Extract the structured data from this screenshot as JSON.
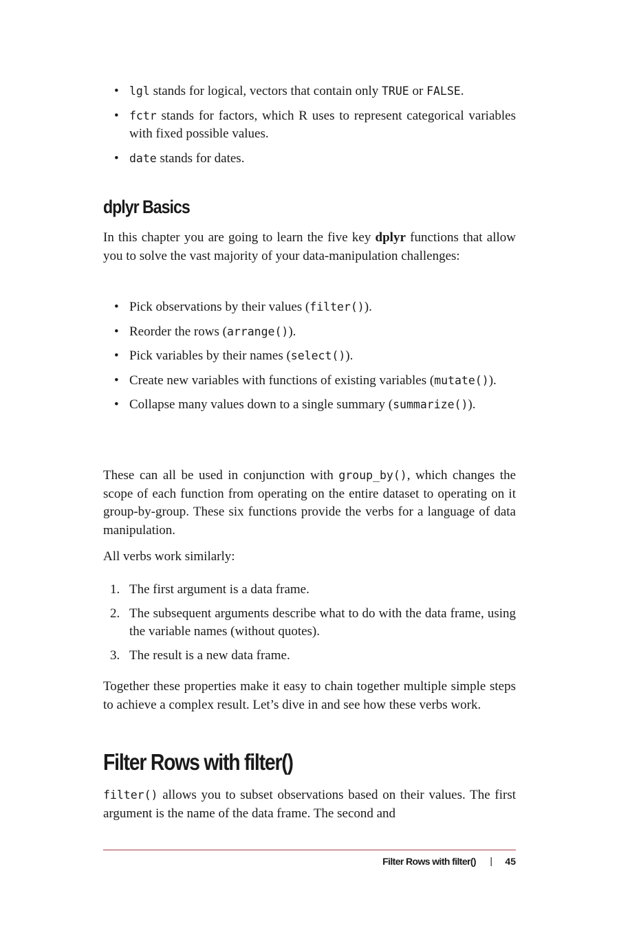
{
  "types_list": [
    {
      "code": "lgl",
      "text": " stands for logical, vectors that contain only ",
      "code2": "TRUE",
      "text2": " or ",
      "code3": "FALSE",
      "text3": "."
    },
    {
      "code": "fctr",
      "text": " stands for factors, which R uses to represent categorical variables with fixed possible values."
    },
    {
      "code": "date",
      "text": " stands for dates."
    }
  ],
  "section": {
    "heading": "dplyr Basics",
    "intro_before": "In this chapter you are going to learn the five key ",
    "intro_bold": "dplyr",
    "intro_after": " functions that allow you to solve the vast majority of your data-manipulation challenges:",
    "functions_list": [
      {
        "text": "Pick observations by their values (",
        "code": "filter()",
        "end": ")."
      },
      {
        "text": "Reorder the rows (",
        "code": "arrange()",
        "end": ")."
      },
      {
        "text": "Pick variables by their names (",
        "code": "select()",
        "end": ")."
      },
      {
        "text": "Create new variables with functions of existing variables (",
        "code": "mutate()",
        "end": ")."
      },
      {
        "text": "Collapse many values down to a single summary (",
        "code": "summarize()",
        "end": ")."
      }
    ],
    "group_by_before": "These can all be used in conjunction with ",
    "group_by_code": "group_by()",
    "group_by_after": ", which changes the scope of each function from operating on the entire dataset to operating on it group-by-group. These six functions provide the verbs for a language of data manipulation.",
    "verbs_intro": "All verbs work similarly:",
    "steps": [
      {
        "num": "1.",
        "text": "The first argument is a data frame."
      },
      {
        "num": "2.",
        "text": "The subsequent arguments describe what to do with the data frame, using the variable names (without quotes)."
      },
      {
        "num": "3.",
        "text": "The result is a new data frame."
      }
    ],
    "together": "Together these properties make it easy to chain together multiple simple steps to achieve a complex result. Let’s dive in and see how these verbs work."
  },
  "filter_section": {
    "heading": "Filter Rows with filter()",
    "code": "filter()",
    "text": " allows you to subset observations based on their values. The first argument is the name of the data frame. The second and"
  },
  "footer": {
    "title": "Filter Rows with filter()",
    "separator": "|",
    "page": "45"
  }
}
